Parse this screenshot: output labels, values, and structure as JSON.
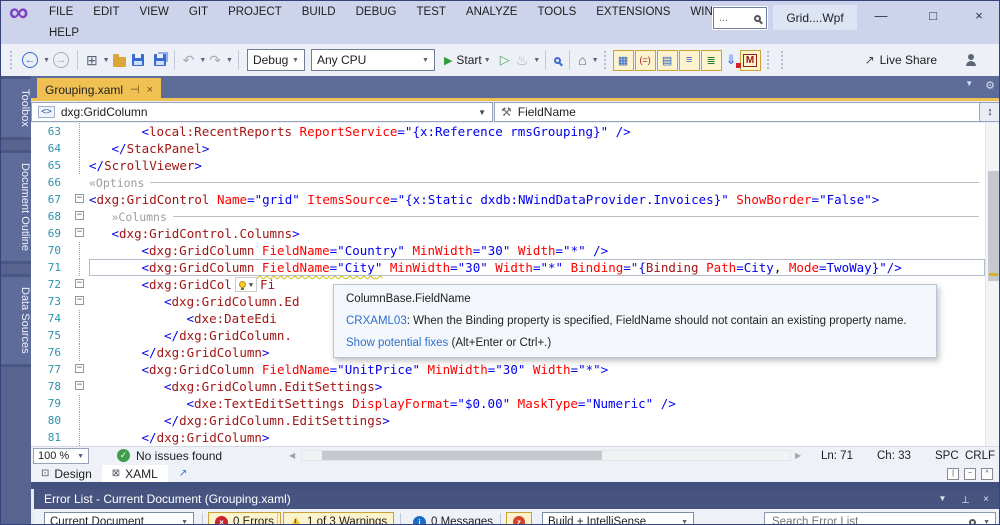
{
  "colors": {
    "vs_purple": "#7b3fc4",
    "titlebar": "#ccd3ea",
    "tab_gold": "#f0c052",
    "frame_slate": "#5d6b99",
    "panel_header_blue": "#475480",
    "error_red": "#c6252e",
    "warning_gold": "#f2c230",
    "info_blue": "#1a6cc8",
    "success_green": "#3f9e4d",
    "line_number_teal": "#2B91AF",
    "squiggle_yellow": "#cfc000"
  },
  "titlebar": {
    "menu_row1": [
      "FILE",
      "EDIT",
      "VIEW",
      "GIT",
      "PROJECT",
      "BUILD",
      "DEBUG",
      "TEST",
      "ANALYZE",
      "TOOLS",
      "EXTENSIONS",
      "WINDOW"
    ],
    "menu_row2": [
      "HELP"
    ],
    "search_placeholder": "...",
    "window_title": "Grid....Wpf"
  },
  "toolbar": {
    "debug_config": "Debug",
    "platform": "Any CPU",
    "start_label": "Start",
    "live_share_label": "Live Share"
  },
  "doc_tab": {
    "label": "Grouping.xaml"
  },
  "navbar": {
    "element_dropdown": "dxg:GridColumn",
    "member_dropdown": "FieldName"
  },
  "sidebar": {
    "tabs": [
      "Toolbox",
      "Document Outline",
      "Data Sources"
    ]
  },
  "tooltip": {
    "title": "ColumnBase.FieldName",
    "code": "CRXAML03",
    "message": ": When the Binding property is specified, FieldName should not contain an existing property name.",
    "fix_link": "Show potential fixes",
    "fix_hint": " (Alt+Enter or Ctrl+.)"
  },
  "editor_status": {
    "zoom": "100 %",
    "issues": "No issues found",
    "line": "Ln: 71",
    "column": "Ch: 33",
    "spaces": "SPC",
    "eol": "CRLF"
  },
  "view_tabs": {
    "design": "Design",
    "xaml": "XAML"
  },
  "error_list": {
    "title": "Error List - Current Document (Grouping.xaml)",
    "scope": "Current Document",
    "errors": "0 Errors",
    "warnings": "1 of 3 Warnings",
    "messages": "0 Messages",
    "source_filter": "Build + IntelliSense",
    "search_placeholder": "Search Error List"
  },
  "icons": {
    "sort_badge": "z",
    "pin": "⊣",
    "gear": "gear-glyph",
    "element": "<>",
    "member_wrench": "wrench-glyph"
  },
  "editor": {
    "lines": [
      {
        "n": 63,
        "indent": 7,
        "m": "l",
        "tokens": [
          {
            "c": "d",
            "t": "<"
          },
          {
            "c": "e",
            "t": "local:RecentReports"
          },
          {
            "c": "a",
            "t": " ReportService"
          },
          {
            "c": "d",
            "t": "=\"{"
          },
          {
            "c": "v",
            "t": "x:Reference rmsGrouping"
          },
          {
            "c": "d",
            "t": "}\" />"
          }
        ]
      },
      {
        "n": 64,
        "indent": 3,
        "m": "l",
        "tokens": [
          {
            "c": "d",
            "t": "</"
          },
          {
            "c": "e",
            "t": "StackPanel"
          },
          {
            "c": "d",
            "t": ">"
          }
        ]
      },
      {
        "n": 65,
        "indent": 0,
        "m": "l",
        "tokens": [
          {
            "c": "d",
            "t": "</"
          },
          {
            "c": "e",
            "t": "ScrollViewer"
          },
          {
            "c": "d",
            "t": ">"
          }
        ]
      },
      {
        "n": 66,
        "indent": 0,
        "m": "",
        "rule": true,
        "tokens": [
          {
            "c": "g",
            "t": "«Options"
          }
        ]
      },
      {
        "n": 67,
        "indent": 0,
        "m": "b",
        "tokens": [
          {
            "c": "d",
            "t": "<"
          },
          {
            "c": "e",
            "t": "dxg:GridControl"
          },
          {
            "c": "a",
            "t": " Name"
          },
          {
            "c": "d",
            "t": "=\""
          },
          {
            "c": "v",
            "t": "grid"
          },
          {
            "c": "d",
            "t": "\" "
          },
          {
            "c": "a",
            "t": "ItemsSource"
          },
          {
            "c": "d",
            "t": "=\"{"
          },
          {
            "c": "v",
            "t": "x:Static dxdb:NWindDataProvider.Invoices"
          },
          {
            "c": "d",
            "t": "}\" "
          },
          {
            "c": "a",
            "t": "ShowBorder"
          },
          {
            "c": "d",
            "t": "=\""
          },
          {
            "c": "v",
            "t": "False"
          },
          {
            "c": "d",
            "t": "\">"
          }
        ]
      },
      {
        "n": 68,
        "indent": 3,
        "m": "b",
        "rule": true,
        "tokens": [
          {
            "c": "g",
            "t": "»Columns"
          }
        ]
      },
      {
        "n": 69,
        "indent": 3,
        "m": "b",
        "tokens": [
          {
            "c": "d",
            "t": "<"
          },
          {
            "c": "e",
            "t": "dxg:GridControl.Columns"
          },
          {
            "c": "d",
            "t": ">"
          }
        ]
      },
      {
        "n": 70,
        "indent": 7,
        "m": "l",
        "tokens": [
          {
            "c": "d",
            "t": "<"
          },
          {
            "c": "e",
            "t": "dxg:GridColumn"
          },
          {
            "c": "a",
            "t": " FieldName"
          },
          {
            "c": "d",
            "t": "=\""
          },
          {
            "c": "v",
            "t": "Country"
          },
          {
            "c": "d",
            "t": "\" "
          },
          {
            "c": "a",
            "t": "MinWidth"
          },
          {
            "c": "d",
            "t": "=\""
          },
          {
            "c": "v",
            "t": "30"
          },
          {
            "c": "d",
            "t": "\" "
          },
          {
            "c": "a",
            "t": "Width"
          },
          {
            "c": "d",
            "t": "=\""
          },
          {
            "c": "v",
            "t": "*"
          },
          {
            "c": "d",
            "t": "\" />"
          }
        ]
      },
      {
        "n": 71,
        "indent": 7,
        "m": "l",
        "cur": true,
        "tokens": [
          {
            "c": "d",
            "t": "<"
          },
          {
            "c": "e",
            "t": "dxg:GridColumn"
          },
          {
            "c": "a",
            "t": " FieldName",
            "sq": true
          },
          {
            "c": "d",
            "t": "=\"",
            "sq": true
          },
          {
            "c": "v",
            "t": "City",
            "sq": true
          },
          {
            "c": "d",
            "t": "\"",
            "sq": true
          },
          {
            "c": "t",
            "t": " "
          },
          {
            "c": "a",
            "t": "MinWidth"
          },
          {
            "c": "d",
            "t": "=\""
          },
          {
            "c": "v",
            "t": "30"
          },
          {
            "c": "d",
            "t": "\" "
          },
          {
            "c": "a",
            "t": "Width"
          },
          {
            "c": "d",
            "t": "=\""
          },
          {
            "c": "v",
            "t": "*"
          },
          {
            "c": "d",
            "t": "\" "
          },
          {
            "c": "a",
            "t": "Binding"
          },
          {
            "c": "d",
            "t": "=\"{"
          },
          {
            "c": "m",
            "t": "Binding"
          },
          {
            "c": "t",
            "t": " "
          },
          {
            "c": "a",
            "t": "Path"
          },
          {
            "c": "d",
            "t": "="
          },
          {
            "c": "v",
            "t": "City"
          },
          {
            "c": "t",
            "t": ", "
          },
          {
            "c": "a",
            "t": "Mode"
          },
          {
            "c": "d",
            "t": "="
          },
          {
            "c": "v",
            "t": "TwoWay"
          },
          {
            "c": "d",
            "t": "}\"/>"
          }
        ]
      },
      {
        "n": 72,
        "indent": 7,
        "m": "b",
        "tokens": [
          {
            "c": "d",
            "t": "<"
          },
          {
            "c": "e",
            "t": "dxg:GridCol"
          },
          {
            "c": "bulb",
            "t": ""
          },
          {
            "c": "e",
            "t": "Fi"
          }
        ]
      },
      {
        "n": 73,
        "indent": 10,
        "m": "b",
        "tokens": [
          {
            "c": "d",
            "t": "<"
          },
          {
            "c": "e",
            "t": "dxg:GridColumn.Ed"
          }
        ]
      },
      {
        "n": 74,
        "indent": 13,
        "m": "l",
        "tokens": [
          {
            "c": "d",
            "t": "<"
          },
          {
            "c": "e",
            "t": "dxe:DateEdi"
          }
        ]
      },
      {
        "n": 75,
        "indent": 10,
        "m": "l",
        "tokens": [
          {
            "c": "d",
            "t": "</"
          },
          {
            "c": "e",
            "t": "dxg:GridColumn."
          }
        ]
      },
      {
        "n": 76,
        "indent": 7,
        "m": "l",
        "tokens": [
          {
            "c": "d",
            "t": "</"
          },
          {
            "c": "e",
            "t": "dxg:GridColumn"
          },
          {
            "c": "d",
            "t": ">"
          }
        ]
      },
      {
        "n": 77,
        "indent": 7,
        "m": "b",
        "tokens": [
          {
            "c": "d",
            "t": "<"
          },
          {
            "c": "e",
            "t": "dxg:GridColumn"
          },
          {
            "c": "a",
            "t": " FieldName"
          },
          {
            "c": "d",
            "t": "=\""
          },
          {
            "c": "v",
            "t": "UnitPrice"
          },
          {
            "c": "d",
            "t": "\" "
          },
          {
            "c": "a",
            "t": "MinWidth"
          },
          {
            "c": "d",
            "t": "=\""
          },
          {
            "c": "v",
            "t": "30"
          },
          {
            "c": "d",
            "t": "\" "
          },
          {
            "c": "a",
            "t": "Width"
          },
          {
            "c": "d",
            "t": "=\""
          },
          {
            "c": "v",
            "t": "*"
          },
          {
            "c": "d",
            "t": "\">"
          }
        ]
      },
      {
        "n": 78,
        "indent": 10,
        "m": "b",
        "tokens": [
          {
            "c": "d",
            "t": "<"
          },
          {
            "c": "e",
            "t": "dxg:GridColumn.EditSettings"
          },
          {
            "c": "d",
            "t": ">"
          }
        ]
      },
      {
        "n": 79,
        "indent": 13,
        "m": "l",
        "tokens": [
          {
            "c": "d",
            "t": "<"
          },
          {
            "c": "e",
            "t": "dxe:TextEditSettings"
          },
          {
            "c": "a",
            "t": " DisplayFormat"
          },
          {
            "c": "d",
            "t": "=\""
          },
          {
            "c": "v",
            "t": "$0.00"
          },
          {
            "c": "d",
            "t": "\" "
          },
          {
            "c": "a",
            "t": "MaskType"
          },
          {
            "c": "d",
            "t": "=\""
          },
          {
            "c": "v",
            "t": "Numeric"
          },
          {
            "c": "d",
            "t": "\" />"
          }
        ]
      },
      {
        "n": 80,
        "indent": 10,
        "m": "l",
        "tokens": [
          {
            "c": "d",
            "t": "</"
          },
          {
            "c": "e",
            "t": "dxg:GridColumn.EditSettings"
          },
          {
            "c": "d",
            "t": ">"
          }
        ]
      },
      {
        "n": 81,
        "indent": 7,
        "m": "l",
        "tokens": [
          {
            "c": "d",
            "t": "</"
          },
          {
            "c": "e",
            "t": "dxg:GridColumn"
          },
          {
            "c": "d",
            "t": ">"
          }
        ]
      }
    ]
  }
}
